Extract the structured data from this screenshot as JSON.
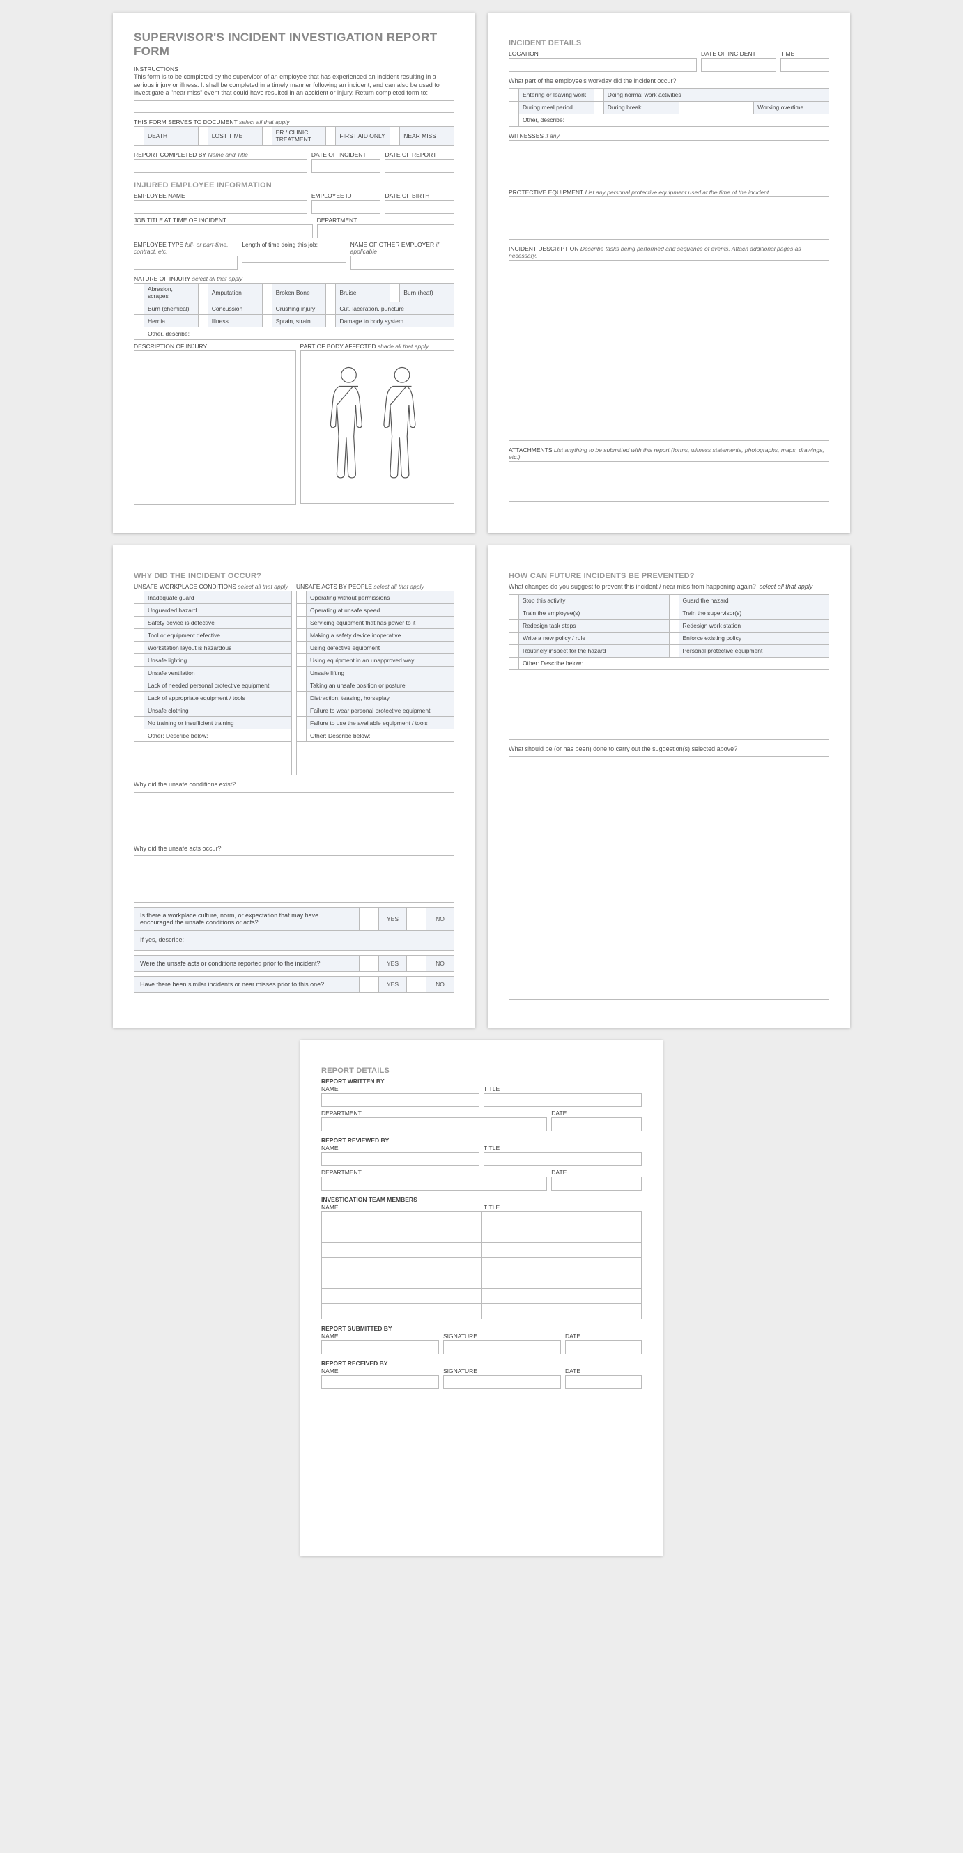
{
  "title": "SUPERVISOR'S INCIDENT INVESTIGATION REPORT FORM",
  "instructions_h": "INSTRUCTIONS",
  "instructions_p": "This form is to be completed by the supervisor of an employee that has experienced an incident resulting in a serious injury or illness. It shall be completed in a timely manner following an incident, and can also be used to investigate a \"near miss\" event that could have resulted in an accident or injury. Return completed form to:",
  "doc_serves": "THIS FORM SERVES TO DOCUMENT",
  "select_all": "select all that apply",
  "serves_opts": [
    "DEATH",
    "LOST TIME",
    "ER / CLINIC TREATMENT",
    "FIRST AID ONLY",
    "NEAR MISS"
  ],
  "rcb": "REPORT COMPLETED BY",
  "name_title": "Name and Title",
  "doi": "DATE OF INCIDENT",
  "dor": "DATE OF REPORT",
  "sec_emp": "INJURED EMPLOYEE INFORMATION",
  "emp_name": "EMPLOYEE NAME",
  "emp_id": "EMPLOYEE ID",
  "dob": "DATE OF BIRTH",
  "job_title": "JOB TITLE AT TIME OF INCIDENT",
  "dept": "DEPARTMENT",
  "emp_type": "EMPLOYEE TYPE",
  "emp_type_hint": "full- or part-time, contract, etc.",
  "len_job": "Length of time doing this job:",
  "other_emp": "NAME OF OTHER EMPLOYER",
  "if_app": "if applicable",
  "nature": "NATURE OF INJURY",
  "nature_opts": [
    [
      "Abrasion, scrapes",
      "Amputation",
      "Broken Bone",
      "Bruise",
      "Burn (heat)"
    ],
    [
      "Burn (chemical)",
      "Concussion",
      "Crushing injury",
      "Cut, laceration, puncture",
      ""
    ],
    [
      "Hernia",
      "Illness",
      "Sprain, strain",
      "Damage to body system",
      ""
    ],
    [
      "Other, describe:",
      "",
      "",
      "",
      ""
    ]
  ],
  "desc_inj": "DESCRIPTION OF INJURY",
  "part_body": "PART OF BODY AFFECTED",
  "shade": "shade all that apply",
  "sec_details": "INCIDENT DETAILS",
  "location": "LOCATION",
  "time": "TIME",
  "workday_q": "What part of the employee's workday did the incident occur?",
  "workday_opts": [
    [
      "Entering or leaving work",
      "Doing normal work activities",
      ""
    ],
    [
      "During meal period",
      "During break",
      "Working overtime"
    ],
    [
      "Other, describe:",
      "",
      ""
    ]
  ],
  "witnesses": "WITNESSES",
  "if_any": "if any",
  "ppe": "PROTECTIVE EQUIPMENT",
  "ppe_hint": "List any personal protective equipment used at the time of the incident.",
  "inc_desc": "INCIDENT DESCRIPTION",
  "inc_desc_hint": "Describe tasks being performed and sequence of events.  Attach additional pages as necessary.",
  "attach": "ATTACHMENTS",
  "attach_hint": "List anything to be submitted with this report (forms, witness statements, photographs, maps, drawings, etc.)",
  "sec_why": "WHY DID THE INCIDENT OCCUR?",
  "unsafe_cond": "UNSAFE WORKPLACE CONDITIONS",
  "unsafe_acts": "UNSAFE ACTS BY PEOPLE",
  "cond_list": [
    "Inadequate guard",
    "Unguarded hazard",
    "Safety device is defective",
    "Tool or equipment defective",
    "Workstation layout is hazardous",
    "Unsafe lighting",
    "Unsafe ventilation",
    "Lack of needed personal protective equipment",
    "Lack of appropriate equipment / tools",
    "Unsafe clothing",
    "No training or insufficient training",
    "Other: Describe below:"
  ],
  "acts_list": [
    "Operating without permissions",
    "Operating at unsafe speed",
    "Servicing equipment that has power to it",
    "Making a safety device inoperative",
    "Using defective equipment",
    "Using equipment in an unapproved way",
    "Unsafe lifting",
    "Taking an unsafe position or posture",
    "Distraction, teasing, horseplay",
    "Failure to wear personal protective equipment",
    "Failure to use the available equipment / tools",
    "Other: Describe below:"
  ],
  "why_cond": "Why did the unsafe conditions exist?",
  "why_acts": "Why did the unsafe acts occur?",
  "culture_q": "Is there a workplace culture, norm, or expectation that may have encouraged the unsafe conditions or acts?",
  "if_yes": "If yes, describe:",
  "reported_q": "Were the unsafe acts or conditions reported prior to the incident?",
  "similar_q": "Have there been similar incidents or near misses prior to this one?",
  "yes": "YES",
  "no": "NO",
  "sec_prevent": "HOW CAN FUTURE INCIDENTS BE PREVENTED?",
  "prevent_q": "What changes do you suggest to prevent this incident / near miss from happening again?",
  "prevent_opts": [
    [
      "Stop this activity",
      "Guard the hazard"
    ],
    [
      "Train the employee(s)",
      "Train the supervisor(s)"
    ],
    [
      "Redesign task steps",
      "Redesign work station"
    ],
    [
      "Write a new policy / rule",
      "Enforce existing policy"
    ],
    [
      "Routinely inspect for the hazard",
      "Personal protective equipment"
    ],
    [
      "Other: Describe below:",
      ""
    ]
  ],
  "carry_out": "What should be (or has been) done to carry out the suggestion(s) selected above?",
  "sec_report": "REPORT DETAILS",
  "written_by": "REPORT WRITTEN BY",
  "reviewed_by": "REPORT REVIEWED BY",
  "team": "INVESTIGATION TEAM MEMBERS",
  "submitted_by": "REPORT SUBMITTED BY",
  "received_by": "REPORT RECEIVED BY",
  "name": "NAME",
  "titlef": "TITLE",
  "date": "DATE",
  "sig": "SIGNATURE"
}
